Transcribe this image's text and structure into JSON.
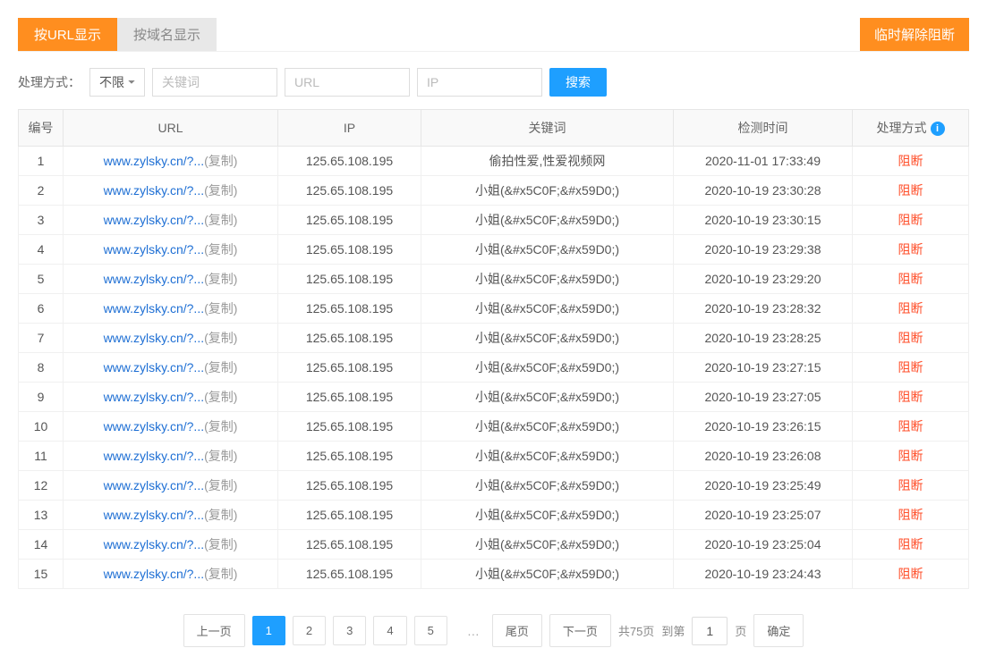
{
  "tabs": {
    "url_view": "按URL显示",
    "domain_view": "按域名显示",
    "unblock_btn": "临时解除阻断"
  },
  "filters": {
    "method_label": "处理方式：",
    "method_value": "不限",
    "kw_placeholder": "关键词",
    "url_placeholder": "URL",
    "ip_placeholder": "IP",
    "search_btn": "搜索"
  },
  "headers": {
    "no": "编号",
    "url": "URL",
    "ip": "IP",
    "kw": "关键词",
    "time": "检测时间",
    "action": "处理方式"
  },
  "copy_label": "(复制)",
  "rows": [
    {
      "no": "1",
      "url": "www.zylsky.cn/?...",
      "ip": "125.65.108.195",
      "kw": "偷拍性爱,性爱视频网",
      "time": "2020-11-01 17:33:49",
      "action": "阻断"
    },
    {
      "no": "2",
      "url": "www.zylsky.cn/?...",
      "ip": "125.65.108.195",
      "kw": "小姐(&#x5C0F;&#x59D0;)",
      "time": "2020-10-19 23:30:28",
      "action": "阻断"
    },
    {
      "no": "3",
      "url": "www.zylsky.cn/?...",
      "ip": "125.65.108.195",
      "kw": "小姐(&#x5C0F;&#x59D0;)",
      "time": "2020-10-19 23:30:15",
      "action": "阻断"
    },
    {
      "no": "4",
      "url": "www.zylsky.cn/?...",
      "ip": "125.65.108.195",
      "kw": "小姐(&#x5C0F;&#x59D0;)",
      "time": "2020-10-19 23:29:38",
      "action": "阻断"
    },
    {
      "no": "5",
      "url": "www.zylsky.cn/?...",
      "ip": "125.65.108.195",
      "kw": "小姐(&#x5C0F;&#x59D0;)",
      "time": "2020-10-19 23:29:20",
      "action": "阻断"
    },
    {
      "no": "6",
      "url": "www.zylsky.cn/?...",
      "ip": "125.65.108.195",
      "kw": "小姐(&#x5C0F;&#x59D0;)",
      "time": "2020-10-19 23:28:32",
      "action": "阻断"
    },
    {
      "no": "7",
      "url": "www.zylsky.cn/?...",
      "ip": "125.65.108.195",
      "kw": "小姐(&#x5C0F;&#x59D0;)",
      "time": "2020-10-19 23:28:25",
      "action": "阻断"
    },
    {
      "no": "8",
      "url": "www.zylsky.cn/?...",
      "ip": "125.65.108.195",
      "kw": "小姐(&#x5C0F;&#x59D0;)",
      "time": "2020-10-19 23:27:15",
      "action": "阻断"
    },
    {
      "no": "9",
      "url": "www.zylsky.cn/?...",
      "ip": "125.65.108.195",
      "kw": "小姐(&#x5C0F;&#x59D0;)",
      "time": "2020-10-19 23:27:05",
      "action": "阻断"
    },
    {
      "no": "10",
      "url": "www.zylsky.cn/?...",
      "ip": "125.65.108.195",
      "kw": "小姐(&#x5C0F;&#x59D0;)",
      "time": "2020-10-19 23:26:15",
      "action": "阻断"
    },
    {
      "no": "11",
      "url": "www.zylsky.cn/?...",
      "ip": "125.65.108.195",
      "kw": "小姐(&#x5C0F;&#x59D0;)",
      "time": "2020-10-19 23:26:08",
      "action": "阻断"
    },
    {
      "no": "12",
      "url": "www.zylsky.cn/?...",
      "ip": "125.65.108.195",
      "kw": "小姐(&#x5C0F;&#x59D0;)",
      "time": "2020-10-19 23:25:49",
      "action": "阻断"
    },
    {
      "no": "13",
      "url": "www.zylsky.cn/?...",
      "ip": "125.65.108.195",
      "kw": "小姐(&#x5C0F;&#x59D0;)",
      "time": "2020-10-19 23:25:07",
      "action": "阻断"
    },
    {
      "no": "14",
      "url": "www.zylsky.cn/?...",
      "ip": "125.65.108.195",
      "kw": "小姐(&#x5C0F;&#x59D0;)",
      "time": "2020-10-19 23:25:04",
      "action": "阻断"
    },
    {
      "no": "15",
      "url": "www.zylsky.cn/?...",
      "ip": "125.65.108.195",
      "kw": "小姐(&#x5C0F;&#x59D0;)",
      "time": "2020-10-19 23:24:43",
      "action": "阻断"
    }
  ],
  "pagination": {
    "prev": "上一页",
    "pages": [
      "1",
      "2",
      "3",
      "4",
      "5"
    ],
    "ellipsis": "…",
    "last": "尾页",
    "next": "下一页",
    "total_label": "共75页",
    "to_label": "到第",
    "page_suffix": "页",
    "current": "1",
    "confirm": "确定"
  }
}
